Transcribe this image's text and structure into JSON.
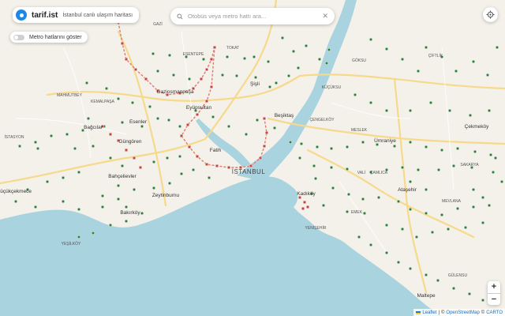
{
  "app": {
    "name": "tarif.ist",
    "subtitle": "İstanbul canlı ulaşım haritası"
  },
  "metro_toggle": {
    "label": "Metro hatlarını göster",
    "checked": false
  },
  "search": {
    "placeholder": "Otobüs veya metro hattı ara...",
    "value": ""
  },
  "attribution": {
    "leaflet": "Leaflet",
    "sep": "|",
    "copy": "©",
    "osm": "OpenStreetMap",
    "copy2": "©",
    "carto": "CARTO"
  },
  "colors": {
    "water": "#a9d3df",
    "land": "#f4f1ea",
    "road": "#f7d98b",
    "bus_stop": "#2e7d3a",
    "metro_stop": "#c2463f",
    "metro_line": "#e07a6a"
  },
  "labels": {
    "major": [
      "Gaziosmanpaşa",
      "Eyüpsultan",
      "Esenler",
      "Bağcılar",
      "Güngören",
      "Bahçelievler",
      "Zeytinburnu",
      "Bakırköy",
      "Fatih",
      "Beşiktaş",
      "Şişli",
      "Ataşehir",
      "Çekmeköy",
      "Ümraniye",
      "Kadıköy",
      "Maltepe",
      "Küçükçekmece"
    ],
    "city": "İSTANBUL",
    "minor": [
      "GAZİ",
      "ESENTEPE",
      "TOKAT",
      "MAHMUTBEY",
      "KEMALPAŞA",
      "İSTASYON",
      "GÖKSU",
      "ÇİFTLİK",
      "MESLEK",
      "VALİ",
      "YEŞİLKÖY",
      "ÇENGELKÖY",
      "KÜÇÜKSU",
      "ÇAMLICA",
      "MEVLANA",
      "GÜLENSU",
      "SAKARYA",
      "EMEK",
      "YENİŞEHİR"
    ]
  }
}
